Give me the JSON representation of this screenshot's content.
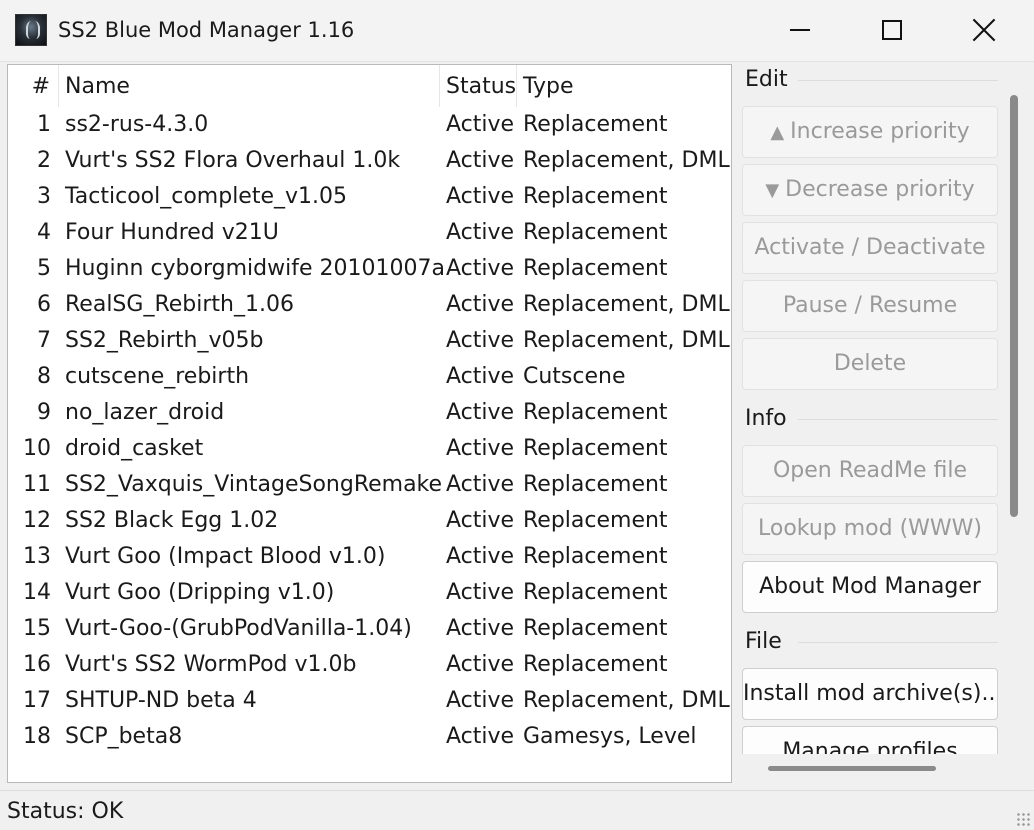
{
  "window": {
    "title": "SS2 Blue Mod Manager 1.16"
  },
  "table": {
    "headers": {
      "num": "#",
      "name": "Name",
      "status": "Status",
      "type": "Type"
    },
    "rows": [
      {
        "num": "1",
        "name": "ss2-rus-4.3.0",
        "status": "Active",
        "type": "Replacement"
      },
      {
        "num": "2",
        "name": "Vurt's SS2 Flora Overhaul 1.0k",
        "status": "Active",
        "type": "Replacement, DML"
      },
      {
        "num": "3",
        "name": "Tacticool_complete_v1.05",
        "status": "Active",
        "type": "Replacement"
      },
      {
        "num": "4",
        "name": "Four Hundred v21U",
        "status": "Active",
        "type": "Replacement"
      },
      {
        "num": "5",
        "name": "Huginn cyborgmidwife 20101007a",
        "status": "Active",
        "type": "Replacement"
      },
      {
        "num": "6",
        "name": "RealSG_Rebirth_1.06",
        "status": "Active",
        "type": "Replacement, DML"
      },
      {
        "num": "7",
        "name": "SS2_Rebirth_v05b",
        "status": "Active",
        "type": "Replacement, DML"
      },
      {
        "num": "8",
        "name": "cutscene_rebirth",
        "status": "Active",
        "type": "Cutscene"
      },
      {
        "num": "9",
        "name": "no_lazer_droid",
        "status": "Active",
        "type": "Replacement"
      },
      {
        "num": "10",
        "name": "droid_casket",
        "status": "Active",
        "type": "Replacement"
      },
      {
        "num": "11",
        "name": "SS2_Vaxquis_VintageSongRemake",
        "status": "Active",
        "type": "Replacement"
      },
      {
        "num": "12",
        "name": "SS2 Black Egg 1.02",
        "status": "Active",
        "type": "Replacement"
      },
      {
        "num": "13",
        "name": "Vurt Goo (Impact Blood v1.0)",
        "status": "Active",
        "type": "Replacement"
      },
      {
        "num": "14",
        "name": "Vurt Goo (Dripping v1.0)",
        "status": "Active",
        "type": "Replacement"
      },
      {
        "num": "15",
        "name": "Vurt-Goo-(GrubPodVanilla-1.04)",
        "status": "Active",
        "type": "Replacement"
      },
      {
        "num": "16",
        "name": "Vurt's SS2 WormPod v1.0b",
        "status": "Active",
        "type": "Replacement"
      },
      {
        "num": "17",
        "name": "SHTUP-ND beta 4",
        "status": "Active",
        "type": "Replacement, DML"
      },
      {
        "num": "18",
        "name": "SCP_beta8",
        "status": "Active",
        "type": "Gamesys, Level"
      }
    ]
  },
  "sidebar": {
    "edit": {
      "label": "Edit",
      "increase": "Increase priority",
      "decrease": "Decrease priority",
      "activate": "Activate / Deactivate",
      "pause": "Pause / Resume",
      "delete": "Delete"
    },
    "info": {
      "label": "Info",
      "readme": "Open ReadMe file",
      "lookup": "Lookup mod (WWW)",
      "about": "About Mod Manager"
    },
    "file": {
      "label": "File",
      "install": "Install mod archive(s)...",
      "profiles": "Manage profiles"
    }
  },
  "status": {
    "text": "Status: OK"
  },
  "icons": {
    "up": "triangle-up-icon",
    "down": "triangle-down-icon"
  }
}
